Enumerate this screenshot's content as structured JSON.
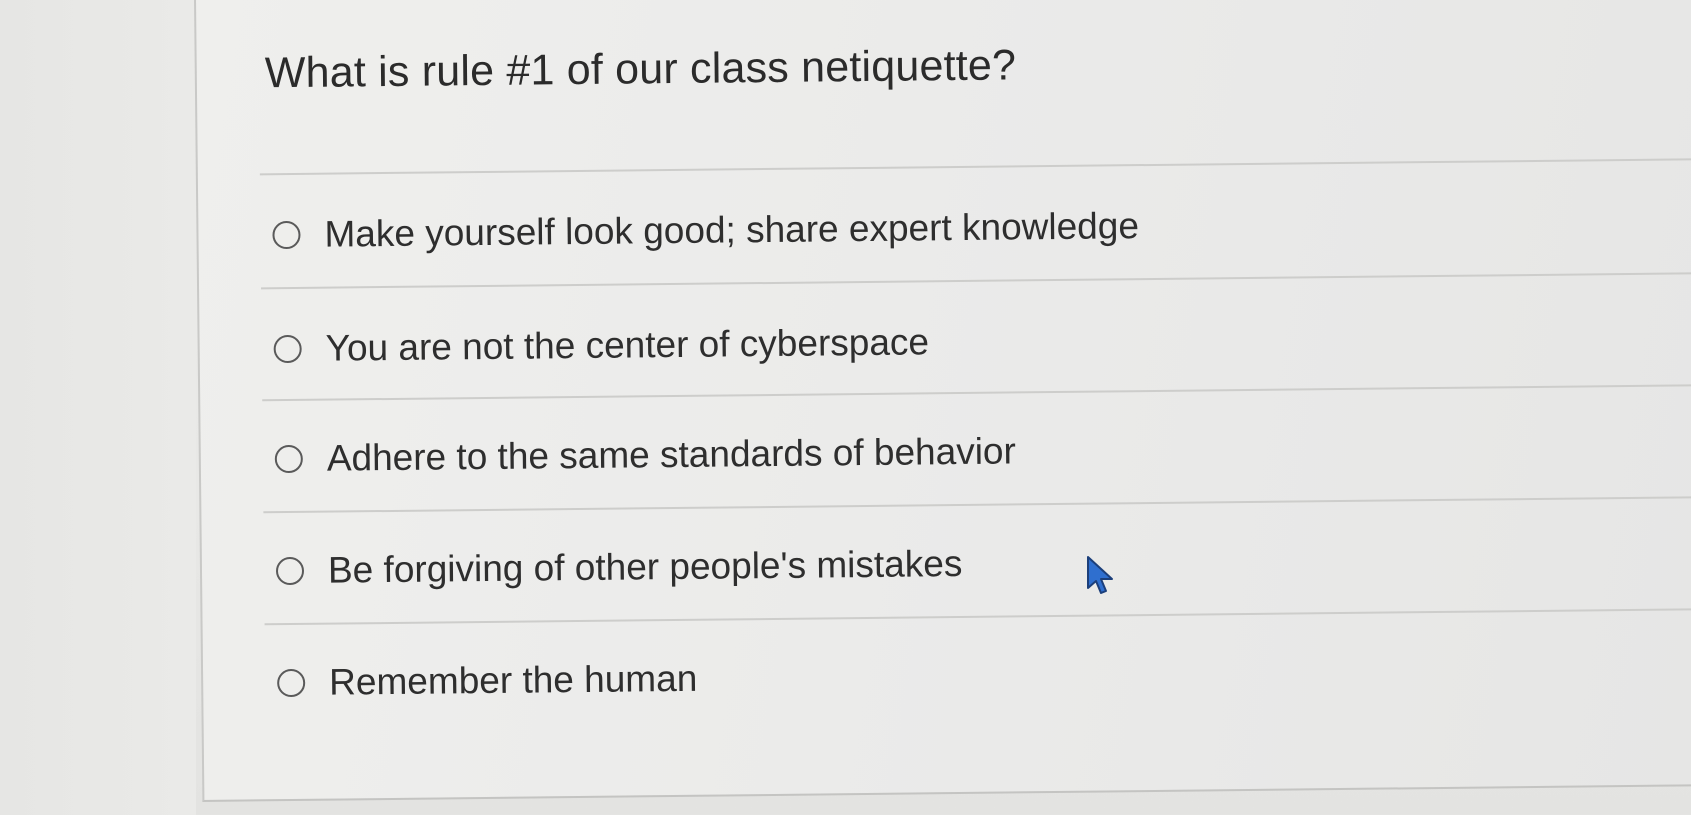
{
  "question": {
    "text": "What is rule #1 of our class netiquette?",
    "options": [
      {
        "label": "Make yourself look good; share expert knowledge",
        "selected": false
      },
      {
        "label": "You are not the center of cyberspace",
        "selected": false
      },
      {
        "label": "Adhere to the same standards of behavior",
        "selected": false
      },
      {
        "label": "Be forgiving of other people's mistakes",
        "selected": false
      },
      {
        "label": "Remember the human",
        "selected": false
      }
    ]
  },
  "pointer": {
    "icon": "mouse-pointer-icon"
  }
}
